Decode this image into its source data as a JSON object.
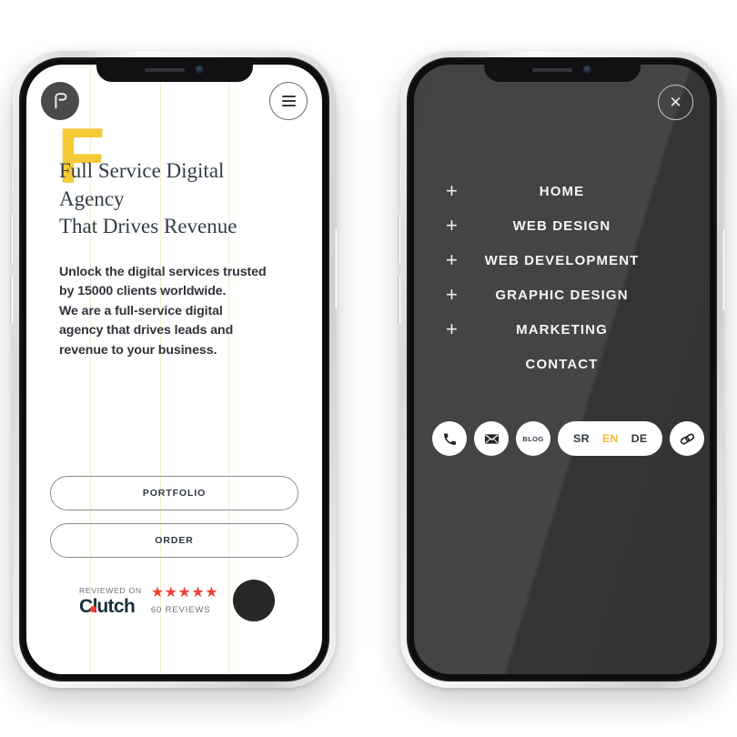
{
  "scene": {
    "background": "#ffffff",
    "accent_yellow": "#f4cb36",
    "dark_screen": "#3a3a3a",
    "guide_line_color": "#f7edd0"
  },
  "phone_left": {
    "name": "home-screen-phone",
    "topbar": {
      "logo": {
        "icon": "p-logo-icon",
        "letter": "P",
        "bg": "#4a4a4a"
      },
      "menu_button": {
        "icon": "hamburger-icon",
        "label": "Menu"
      }
    },
    "hero": {
      "decorative_letter": "F",
      "headline_line1": "Full Service Digital",
      "headline_line2": "Agency",
      "headline_line3": "That Drives Revenue",
      "subcopy_line1": "Unlock the digital services trusted",
      "subcopy_line2": "by 15000 clients worldwide.",
      "subcopy_line3": "We are a full-service digital",
      "subcopy_line4": "agency that drives leads and",
      "subcopy_line5": "revenue to your business."
    },
    "cta": {
      "primary_label": "PORTFOLIO",
      "secondary_label": "ORDER"
    },
    "clutch_badge": {
      "reviewed_on": "REVIEWED ON",
      "brand": "Clutch",
      "brand_pre": "Cl",
      "brand_post": "utch",
      "stars": "★★★★★",
      "star_count": 5,
      "reviews": "60 REVIEWS",
      "star_color": "#ef4335"
    },
    "chat_widget": {
      "icon": "chat-bubble-icon",
      "color": "#272727"
    }
  },
  "phone_right": {
    "name": "menu-overlay-phone",
    "close_button": {
      "icon": "close-icon",
      "glyph": "✕"
    },
    "menu_items": [
      {
        "label": "HOME",
        "expandable": true,
        "expand_glyph": "+"
      },
      {
        "label": "WEB DESIGN",
        "expandable": true,
        "expand_glyph": "+"
      },
      {
        "label": "WEB DEVELOPMENT",
        "expandable": true,
        "expand_glyph": "+"
      },
      {
        "label": "GRAPHIC DESIGN",
        "expandable": true,
        "expand_glyph": "+"
      },
      {
        "label": "MARKETING",
        "expandable": true,
        "expand_glyph": "+"
      },
      {
        "label": "CONTACT",
        "expandable": false,
        "expand_glyph": ""
      }
    ],
    "tools": [
      {
        "name": "phone-icon",
        "label": ""
      },
      {
        "name": "email-icon",
        "label": ""
      },
      {
        "name": "blog-link",
        "label": "BLOG"
      },
      {
        "name": "link-icon",
        "label": ""
      }
    ],
    "languages": [
      {
        "code": "SR",
        "active": false
      },
      {
        "code": "EN",
        "active": true
      },
      {
        "code": "DE",
        "active": false
      }
    ],
    "active_language_color": "#f2b93c"
  }
}
